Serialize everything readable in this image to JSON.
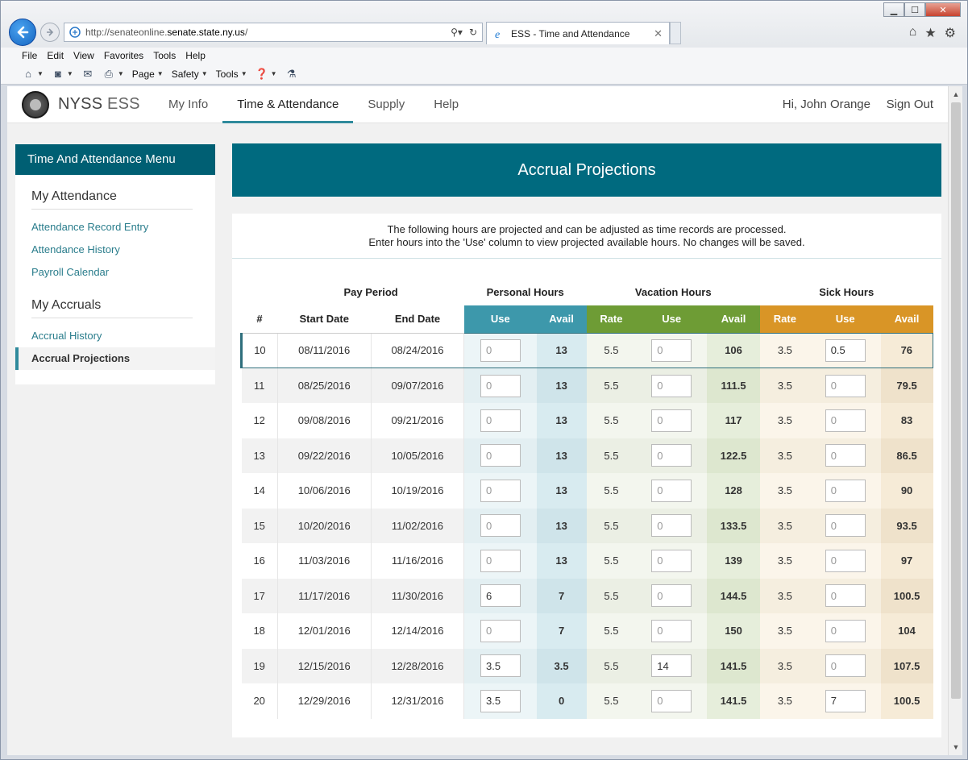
{
  "browser": {
    "url_prefix": "http://senateonline.",
    "url_domain": "senate.state.ny.us",
    "url_suffix": "/",
    "tab_title": "ESS - Time and Attendance",
    "menu": [
      "File",
      "Edit",
      "View",
      "Favorites",
      "Tools",
      "Help"
    ],
    "toolbar": [
      "Page",
      "Safety",
      "Tools"
    ]
  },
  "app": {
    "brand_main": "NYSS",
    "brand_sub": "ESS",
    "nav": [
      "My Info",
      "Time & Attendance",
      "Supply",
      "Help"
    ],
    "active_nav": "Time & Attendance",
    "greeting": "Hi, John Orange",
    "sign_out": "Sign Out"
  },
  "sidebar": {
    "title": "Time And Attendance Menu",
    "attendance_heading": "My Attendance",
    "attendance_links": [
      "Attendance Record Entry",
      "Attendance History",
      "Payroll Calendar"
    ],
    "accruals_heading": "My Accruals",
    "accrual_links": [
      "Accrual History",
      "Accrual Projections"
    ],
    "active_link": "Accrual Projections"
  },
  "content": {
    "title": "Accrual Projections",
    "notice_line1": "The following hours are projected and can be adjusted as time records are processed.",
    "notice_line2": "Enter hours into the 'Use' column to view projected available hours. No changes will be saved."
  },
  "table": {
    "group_headers": {
      "pay_period": "Pay Period",
      "personal": "Personal Hours",
      "vacation": "Vacation Hours",
      "sick": "Sick Hours"
    },
    "column_headers": {
      "num": "#",
      "start": "Start Date",
      "end": "End Date",
      "use": "Use",
      "avail": "Avail",
      "rate": "Rate"
    },
    "colors": {
      "personal": "#3d98ab",
      "vacation": "#6e9c35",
      "sick": "#d99526",
      "title_bar": "#006a7f"
    },
    "rows": [
      {
        "num": "10",
        "start": "08/11/2016",
        "end": "08/24/2016",
        "p_use": "0",
        "p_use_entered": false,
        "p_avail": "13",
        "v_rate": "5.5",
        "v_use": "0",
        "v_use_entered": false,
        "v_avail": "106",
        "s_rate": "3.5",
        "s_use": "0.5",
        "s_use_entered": true,
        "s_avail": "76",
        "selected": true
      },
      {
        "num": "11",
        "start": "08/25/2016",
        "end": "09/07/2016",
        "p_use": "0",
        "p_use_entered": false,
        "p_avail": "13",
        "v_rate": "5.5",
        "v_use": "0",
        "v_use_entered": false,
        "v_avail": "111.5",
        "s_rate": "3.5",
        "s_use": "0",
        "s_use_entered": false,
        "s_avail": "79.5"
      },
      {
        "num": "12",
        "start": "09/08/2016",
        "end": "09/21/2016",
        "p_use": "0",
        "p_use_entered": false,
        "p_avail": "13",
        "v_rate": "5.5",
        "v_use": "0",
        "v_use_entered": false,
        "v_avail": "117",
        "s_rate": "3.5",
        "s_use": "0",
        "s_use_entered": false,
        "s_avail": "83"
      },
      {
        "num": "13",
        "start": "09/22/2016",
        "end": "10/05/2016",
        "p_use": "0",
        "p_use_entered": false,
        "p_avail": "13",
        "v_rate": "5.5",
        "v_use": "0",
        "v_use_entered": false,
        "v_avail": "122.5",
        "s_rate": "3.5",
        "s_use": "0",
        "s_use_entered": false,
        "s_avail": "86.5"
      },
      {
        "num": "14",
        "start": "10/06/2016",
        "end": "10/19/2016",
        "p_use": "0",
        "p_use_entered": false,
        "p_avail": "13",
        "v_rate": "5.5",
        "v_use": "0",
        "v_use_entered": false,
        "v_avail": "128",
        "s_rate": "3.5",
        "s_use": "0",
        "s_use_entered": false,
        "s_avail": "90"
      },
      {
        "num": "15",
        "start": "10/20/2016",
        "end": "11/02/2016",
        "p_use": "0",
        "p_use_entered": false,
        "p_avail": "13",
        "v_rate": "5.5",
        "v_use": "0",
        "v_use_entered": false,
        "v_avail": "133.5",
        "s_rate": "3.5",
        "s_use": "0",
        "s_use_entered": false,
        "s_avail": "93.5"
      },
      {
        "num": "16",
        "start": "11/03/2016",
        "end": "11/16/2016",
        "p_use": "0",
        "p_use_entered": false,
        "p_avail": "13",
        "v_rate": "5.5",
        "v_use": "0",
        "v_use_entered": false,
        "v_avail": "139",
        "s_rate": "3.5",
        "s_use": "0",
        "s_use_entered": false,
        "s_avail": "97"
      },
      {
        "num": "17",
        "start": "11/17/2016",
        "end": "11/30/2016",
        "p_use": "6",
        "p_use_entered": true,
        "p_avail": "7",
        "v_rate": "5.5",
        "v_use": "0",
        "v_use_entered": false,
        "v_avail": "144.5",
        "s_rate": "3.5",
        "s_use": "0",
        "s_use_entered": false,
        "s_avail": "100.5"
      },
      {
        "num": "18",
        "start": "12/01/2016",
        "end": "12/14/2016",
        "p_use": "0",
        "p_use_entered": false,
        "p_avail": "7",
        "v_rate": "5.5",
        "v_use": "0",
        "v_use_entered": false,
        "v_avail": "150",
        "s_rate": "3.5",
        "s_use": "0",
        "s_use_entered": false,
        "s_avail": "104"
      },
      {
        "num": "19",
        "start": "12/15/2016",
        "end": "12/28/2016",
        "p_use": "3.5",
        "p_use_entered": true,
        "p_avail": "3.5",
        "v_rate": "5.5",
        "v_use": "14",
        "v_use_entered": true,
        "v_avail": "141.5",
        "s_rate": "3.5",
        "s_use": "0",
        "s_use_entered": false,
        "s_avail": "107.5"
      },
      {
        "num": "20",
        "start": "12/29/2016",
        "end": "12/31/2016",
        "p_use": "3.5",
        "p_use_entered": true,
        "p_avail": "0",
        "v_rate": "5.5",
        "v_use": "0",
        "v_use_entered": false,
        "v_avail": "141.5",
        "s_rate": "3.5",
        "s_use": "7",
        "s_use_entered": true,
        "s_avail": "100.5"
      }
    ]
  }
}
